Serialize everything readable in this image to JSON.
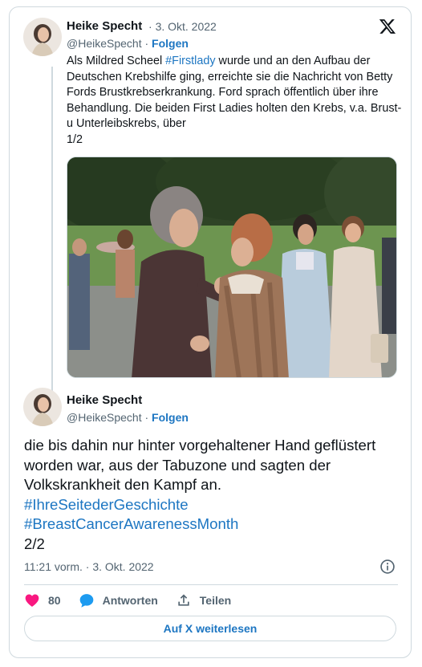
{
  "tweet1": {
    "author_name": "Heike Specht",
    "separator": "·",
    "date": "3. Okt. 2022",
    "handle": "@HeikeSpecht",
    "dot": "·",
    "follow_label": "Folgen",
    "text_part1": "Als Mildred Scheel ",
    "hashtag": "#Firstlady",
    "text_part2": " wurde und an den Aufbau der Deutschen Krebshilfe ging, erreichte sie die Nachricht von Betty Fords Brustkrebserkrankung. Ford sprach öffentlich über ihre Behandlung. Die beiden First Ladies holten den Krebs, v.a. Brust- u Unterleibskrebs, über",
    "counter": "1/2"
  },
  "tweet2": {
    "author_name": "Heike Specht",
    "handle": "@HeikeSpecht",
    "dot": "·",
    "follow_label": "Folgen",
    "text": "die bis dahin nur hinter vorgehaltener Hand geflüstert worden war, aus der Tabuzone und sagten der Volkskrankheit den Kampf an.",
    "hashtag1": "#IhreSeitederGeschichte",
    "hashtag2": "#BreastCancerAwarenessMonth",
    "counter": "2/2",
    "timestamp": "11:21 vorm. · 3. Okt. 2022"
  },
  "actions": {
    "likes": "80",
    "reply_label": "Antworten",
    "share_label": "Teilen"
  },
  "read_more_label": "Auf X weiterlesen",
  "icons": [
    "x-logo-icon",
    "info-icon",
    "heart-icon",
    "reply-bubble-icon",
    "share-upload-icon"
  ],
  "colors": {
    "link": "#1d76c2",
    "like": "#f91880",
    "border": "#cfd9de",
    "muted": "#536471"
  }
}
